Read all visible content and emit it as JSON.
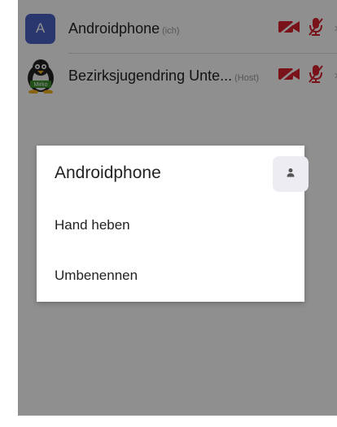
{
  "participants": [
    {
      "avatar_letter": "A",
      "name": "Androidphone",
      "tag": "(ich)",
      "avatar_color": "#4a62c4",
      "icons": [
        "video-off-icon",
        "mic-muted-icon"
      ]
    },
    {
      "avatar_label": "Mirko",
      "name": "Bezirksjugendring Unte...",
      "tag": "(Host)",
      "icons": [
        "video-off-icon",
        "mic-muted-icon"
      ]
    }
  ],
  "dialog": {
    "title": "Androidphone",
    "profile_icon": "person-icon",
    "items": [
      "Hand heben",
      "Umbenennen"
    ]
  },
  "colors": {
    "muted_red": "#d9232e",
    "overlay": "rgba(0,0,0,0.44)",
    "avatar_blue": "#4a62c4"
  }
}
